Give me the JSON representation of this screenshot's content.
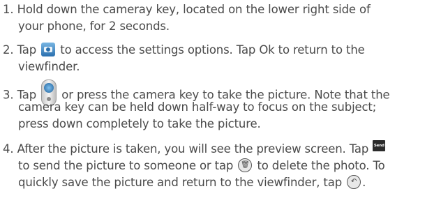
{
  "steps": [
    {
      "number": "1.",
      "lines": [
        "Hold down the cameray key, located on the lower right side of",
        "your phone, for 2 seconds."
      ]
    },
    {
      "number": "2.",
      "line1_a": "Tap",
      "line1_b": "to access the settings options. Tap Ok to return to the",
      "line2": "viewfinder."
    },
    {
      "number": "3.",
      "line1_a": "Tap",
      "line1_b": "or press the camera key to take the picture. Note that the",
      "line2": "camera key can be held down half-way to focus on the subject;",
      "line3": "press down completely to take the picture."
    },
    {
      "number": "4.",
      "line1_a": "After the picture is taken, you will see the preview screen. Tap",
      "send_icon_text": "Send",
      "line2_a": "to send the picture to someone or tap",
      "line2_b": "to delete the photo. To",
      "line3_a": "quickly save the picture and return to the viewfinder, tap",
      "line3_b": "."
    }
  ],
  "icons": {
    "settings": "camera-settings-icon",
    "shutter": "camera-shutter-icon",
    "send": "send-icon",
    "delete": "trash-icon",
    "back": "return-arrow-icon"
  }
}
